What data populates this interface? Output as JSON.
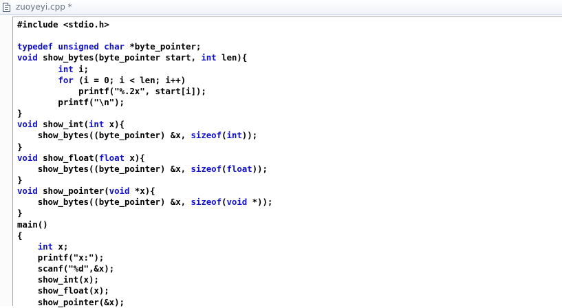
{
  "window": {
    "title": "zuoyeyi.cpp *",
    "file_icon": "document-icon"
  },
  "colors": {
    "keyword": "#1010c8",
    "text": "#000000",
    "title_text": "#6b7280"
  },
  "editor": {
    "lines": [
      [
        {
          "t": "#include <stdio.h>"
        }
      ],
      [],
      [
        {
          "t": "typedef unsigned char",
          "k": 1
        },
        {
          "t": " *byte_pointer;"
        }
      ],
      [
        {
          "t": "void",
          "k": 1
        },
        {
          "t": " show_bytes(byte_pointer start, "
        },
        {
          "t": "int",
          "k": 1
        },
        {
          "t": " len){"
        }
      ],
      [
        {
          "t": "        "
        },
        {
          "t": "int",
          "k": 1
        },
        {
          "t": " i;"
        }
      ],
      [
        {
          "t": "        "
        },
        {
          "t": "for",
          "k": 1
        },
        {
          "t": " (i = 0; i < len; i++)"
        }
      ],
      [
        {
          "t": "            printf(\"%.2x\", start[i]);"
        }
      ],
      [
        {
          "t": "        printf(\"\\n\");"
        }
      ],
      [
        {
          "t": "}"
        }
      ],
      [
        {
          "t": "void",
          "k": 1
        },
        {
          "t": " show_int("
        },
        {
          "t": "int",
          "k": 1
        },
        {
          "t": " x){"
        }
      ],
      [
        {
          "t": "    show_bytes((byte_pointer) &x, "
        },
        {
          "t": "sizeof",
          "k": 1
        },
        {
          "t": "("
        },
        {
          "t": "int",
          "k": 1
        },
        {
          "t": "));"
        }
      ],
      [
        {
          "t": "}"
        }
      ],
      [
        {
          "t": "void",
          "k": 1
        },
        {
          "t": " show_float("
        },
        {
          "t": "float",
          "k": 1
        },
        {
          "t": " x){"
        }
      ],
      [
        {
          "t": "    show_bytes((byte_pointer) &x, "
        },
        {
          "t": "sizeof",
          "k": 1
        },
        {
          "t": "("
        },
        {
          "t": "float",
          "k": 1
        },
        {
          "t": "));"
        }
      ],
      [
        {
          "t": "}"
        }
      ],
      [
        {
          "t": "void",
          "k": 1
        },
        {
          "t": " show_pointer("
        },
        {
          "t": "void",
          "k": 1
        },
        {
          "t": " *x){"
        }
      ],
      [
        {
          "t": "    show_bytes((byte_pointer) &x, "
        },
        {
          "t": "sizeof",
          "k": 1
        },
        {
          "t": "("
        },
        {
          "t": "void",
          "k": 1
        },
        {
          "t": " *));"
        }
      ],
      [
        {
          "t": "}"
        }
      ],
      [
        {
          "t": "main()"
        }
      ],
      [
        {
          "t": "{"
        }
      ],
      [
        {
          "t": "    "
        },
        {
          "t": "int",
          "k": 1
        },
        {
          "t": " x;"
        }
      ],
      [
        {
          "t": "    printf(\"x:\");"
        }
      ],
      [
        {
          "t": "    scanf(\"%d\",&x);"
        }
      ],
      [
        {
          "t": "    show_int(x);"
        }
      ],
      [
        {
          "t": "    show_float(x);"
        }
      ],
      [
        {
          "t": "    show_pointer(&x);"
        }
      ]
    ]
  }
}
